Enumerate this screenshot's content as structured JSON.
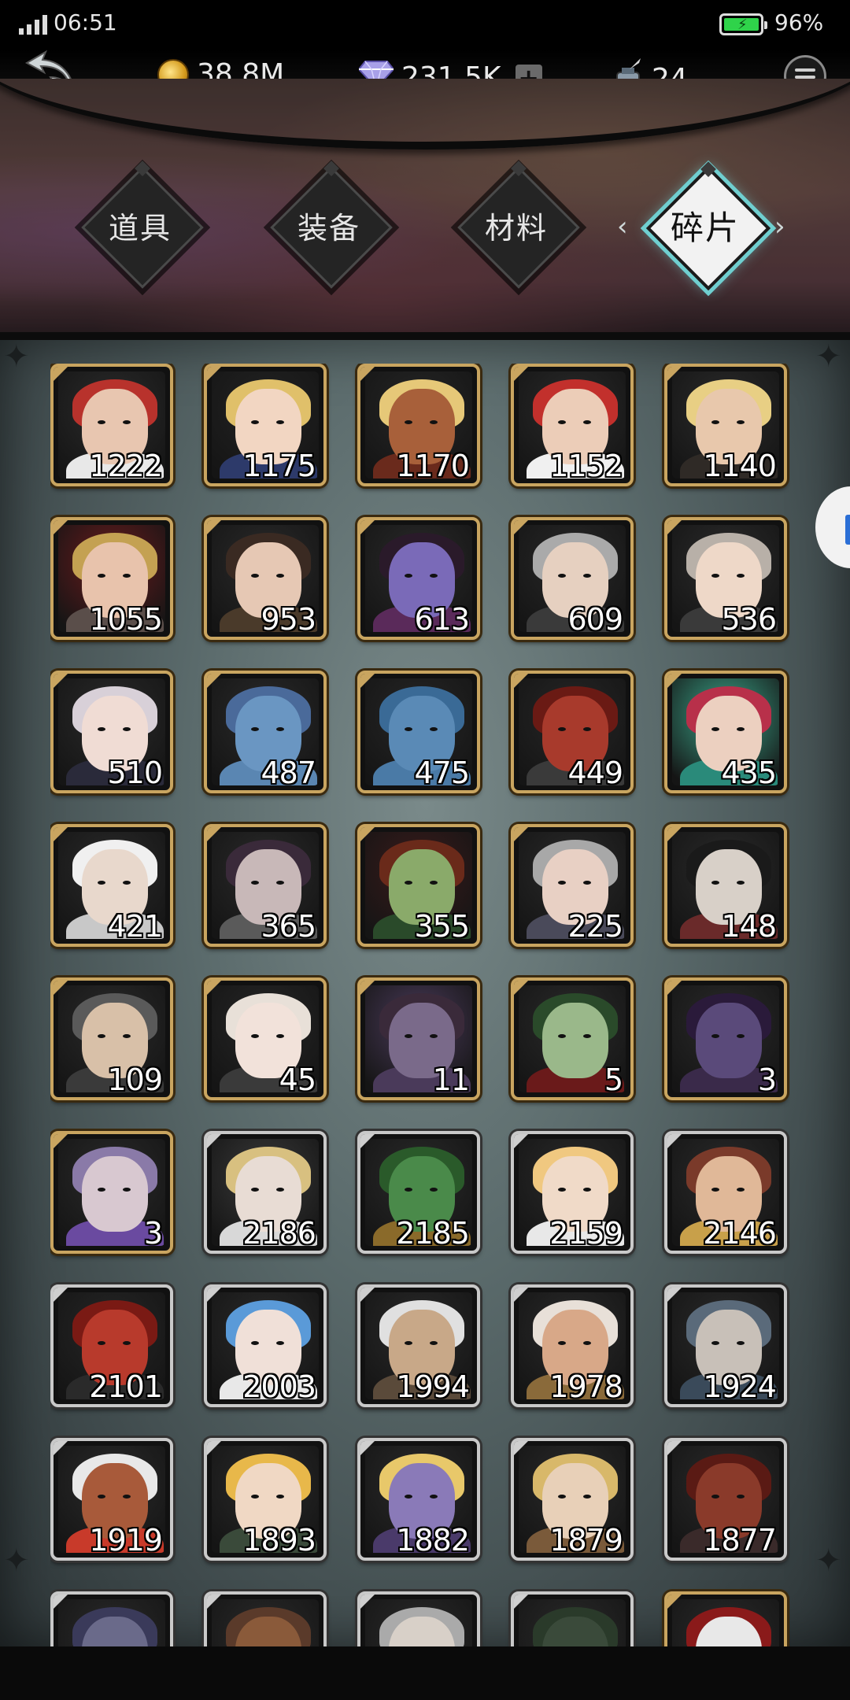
{
  "status": {
    "time": "06:51",
    "battery": "96%"
  },
  "resources": {
    "gold": "38.8M",
    "gems": "231.5K",
    "ink": "24"
  },
  "tabs": [
    {
      "label": "道具",
      "active": false
    },
    {
      "label": "装备",
      "active": false
    },
    {
      "label": "材料",
      "active": false
    },
    {
      "label": "碎片",
      "active": true
    }
  ],
  "shards": [
    {
      "count": "1222",
      "frame": "gold",
      "skin": "#e8c6b0",
      "hair": "#b8322c",
      "outfit": "#e8e8e8",
      "bg": "#2b2b2b"
    },
    {
      "count": "1175",
      "frame": "gold",
      "skin": "#f2d6c2",
      "hair": "#e0c06a",
      "outfit": "#2d3a6a",
      "bg": "#232323"
    },
    {
      "count": "1170",
      "frame": "gold",
      "skin": "#a8603a",
      "hair": "#e6c878",
      "outfit": "#6a2a1c",
      "bg": "#262626"
    },
    {
      "count": "1152",
      "frame": "gold",
      "skin": "#eccdb8",
      "hair": "#c2302c",
      "outfit": "#f0f0f0",
      "bg": "#2a2a2a"
    },
    {
      "count": "1140",
      "frame": "gold",
      "skin": "#e8c8ac",
      "hair": "#e8cf84",
      "outfit": "#2f2a26",
      "bg": "#2b2b2b"
    },
    {
      "count": "1055",
      "frame": "gold",
      "skin": "#e8c3ac",
      "hair": "#c4a152",
      "outfit": "#5a4e4a",
      "bg": "#6a1a1c"
    },
    {
      "count": "953",
      "frame": "gold",
      "skin": "#e6c8b4",
      "hair": "#3a2a22",
      "outfit": "#4a3a2a",
      "bg": "#2a2a2a"
    },
    {
      "count": "613",
      "frame": "gold",
      "skin": "#7a6ab8",
      "hair": "#2a1a2a",
      "outfit": "#5a2a5a",
      "bg": "#2a2a2a"
    },
    {
      "count": "609",
      "frame": "gold",
      "skin": "#e6d0c0",
      "hair": "#aaaaaa",
      "outfit": "#3a3a3a",
      "bg": "#282828"
    },
    {
      "count": "536",
      "frame": "gold",
      "skin": "#eed8c8",
      "hair": "#b8b0a8",
      "outfit": "#3a3a3a",
      "bg": "#2b2b2b"
    },
    {
      "count": "510",
      "frame": "gold",
      "skin": "#f0dcd4",
      "hair": "#d8d0d8",
      "outfit": "#2a2a3a",
      "bg": "#2a2a2a"
    },
    {
      "count": "487",
      "frame": "gold",
      "skin": "#6a96c2",
      "hair": "#4a6a9a",
      "outfit": "#5a86b2",
      "bg": "#2a2a2a"
    },
    {
      "count": "475",
      "frame": "gold",
      "skin": "#5a8ab6",
      "hair": "#3a6a96",
      "outfit": "#4a7aa6",
      "bg": "#262626"
    },
    {
      "count": "449",
      "frame": "gold",
      "skin": "#a83a2c",
      "hair": "#6a1a14",
      "outfit": "#3a3a3a",
      "bg": "#262626"
    },
    {
      "count": "435",
      "frame": "gold",
      "skin": "#ecd0c0",
      "hair": "#b8304a",
      "outfit": "#2a8a7a",
      "bg": "#3aa68a"
    },
    {
      "count": "421",
      "frame": "gold",
      "skin": "#e8d8cc",
      "hair": "#f0f0f0",
      "outfit": "#c8c8c8",
      "bg": "#2a2a2a"
    },
    {
      "count": "365",
      "frame": "gold",
      "skin": "#c8b8b8",
      "hair": "#3a2a3a",
      "outfit": "#5a5a5a",
      "bg": "#2a2a2a"
    },
    {
      "count": "355",
      "frame": "gold",
      "skin": "#8aaa6a",
      "hair": "#6a2a1a",
      "outfit": "#2a4a2a",
      "bg": "#3a1a1a"
    },
    {
      "count": "225",
      "frame": "gold",
      "skin": "#e8d0c4",
      "hair": "#a8a8a8",
      "outfit": "#4a4a5a",
      "bg": "#2a2a2a"
    },
    {
      "count": "148",
      "frame": "gold",
      "skin": "#d8d0c8",
      "hair": "#1a1a1a",
      "outfit": "#6a2a2a",
      "bg": "#2a2a2a"
    },
    {
      "count": "109",
      "frame": "gold",
      "skin": "#d8c0a8",
      "hair": "#5a5a5a",
      "outfit": "#3a3a3a",
      "bg": "#2a2a2a"
    },
    {
      "count": "45",
      "frame": "gold",
      "skin": "#f2e2da",
      "hair": "#e8e0d8",
      "outfit": "#3a3a3a",
      "bg": "#262626"
    },
    {
      "count": "11",
      "frame": "gold",
      "skin": "#7a6a8a",
      "hair": "#3a2a3a",
      "outfit": "#4a3a5a",
      "bg": "#4a3a5a"
    },
    {
      "count": "5",
      "frame": "gold",
      "skin": "#9ab88a",
      "hair": "#2a4a2a",
      "outfit": "#6a1a1a",
      "bg": "#2a2a2a"
    },
    {
      "count": "3",
      "frame": "gold",
      "skin": "#5a4a7a",
      "hair": "#2a1a3a",
      "outfit": "#3a2a4a",
      "bg": "#2a2a2a"
    },
    {
      "count": "3",
      "frame": "gold",
      "skin": "#d8c8d0",
      "hair": "#8a7aa8",
      "outfit": "#6a4aa0",
      "bg": "#2a2a2a"
    },
    {
      "count": "2186",
      "frame": "silver",
      "skin": "#e8dcd4",
      "hair": "#d8c080",
      "outfit": "#d8d8d8",
      "bg": "#3a3a3a"
    },
    {
      "count": "2185",
      "frame": "silver",
      "skin": "#4a8a4a",
      "hair": "#2a5a2a",
      "outfit": "#8a6a2a",
      "bg": "#2a2a2a"
    },
    {
      "count": "2159",
      "frame": "silver",
      "skin": "#f0dac8",
      "hair": "#f0c880",
      "outfit": "#e8e8e8",
      "bg": "#2a2a2a"
    },
    {
      "count": "2146",
      "frame": "silver",
      "skin": "#e0b898",
      "hair": "#7a3a2a",
      "outfit": "#c8a04a",
      "bg": "#2a2a2a"
    },
    {
      "count": "2101",
      "frame": "silver",
      "skin": "#b83a2c",
      "hair": "#7a1a14",
      "outfit": "#2a2a2a",
      "bg": "#262626"
    },
    {
      "count": "2003",
      "frame": "silver",
      "skin": "#f0e0d8",
      "hair": "#5a9ad8",
      "outfit": "#e8e8e8",
      "bg": "#2a2a2a"
    },
    {
      "count": "1994",
      "frame": "silver",
      "skin": "#c8a888",
      "hair": "#e0e0e0",
      "outfit": "#5a4a3a",
      "bg": "#2a2a2a"
    },
    {
      "count": "1978",
      "frame": "silver",
      "skin": "#d8a888",
      "hair": "#e8e0d8",
      "outfit": "#8a6a3a",
      "bg": "#2a2a2a"
    },
    {
      "count": "1924",
      "frame": "silver",
      "skin": "#c8c0b8",
      "hair": "#5a6a7a",
      "outfit": "#3a4a5a",
      "bg": "#2a2a2a"
    },
    {
      "count": "1919",
      "frame": "silver",
      "skin": "#a85a3a",
      "hair": "#e8e8e8",
      "outfit": "#c83a2a",
      "bg": "#2a2a2a"
    },
    {
      "count": "1893",
      "frame": "silver",
      "skin": "#f0d8c4",
      "hair": "#e8b84a",
      "outfit": "#3a4a3a",
      "bg": "#2a2a2a"
    },
    {
      "count": "1882",
      "frame": "silver",
      "skin": "#8a7ab8",
      "hair": "#e8c86a",
      "outfit": "#4a3a6a",
      "bg": "#2a2a2a"
    },
    {
      "count": "1879",
      "frame": "silver",
      "skin": "#e8d0b8",
      "hair": "#d8b86a",
      "outfit": "#7a5a3a",
      "bg": "#2a2a2a"
    },
    {
      "count": "1877",
      "frame": "silver",
      "skin": "#8a3a2a",
      "hair": "#5a1a14",
      "outfit": "#3a2a2a",
      "bg": "#2a2a2a"
    },
    {
      "count": "",
      "frame": "silver",
      "skin": "#6a6a8a",
      "hair": "#3a3a5a",
      "outfit": "#3a3a3a",
      "bg": "#2a2a2a"
    },
    {
      "count": "",
      "frame": "silver",
      "skin": "#8a5a3a",
      "hair": "#5a3a2a",
      "outfit": "#3a3a3a",
      "bg": "#2a2a2a"
    },
    {
      "count": "",
      "frame": "silver",
      "skin": "#d8d0c8",
      "hair": "#aaaaaa",
      "outfit": "#3a3a3a",
      "bg": "#2a2a2a"
    },
    {
      "count": "",
      "frame": "silver",
      "skin": "#3a4a3a",
      "hair": "#2a3a2a",
      "outfit": "#3a3a3a",
      "bg": "#2a2a2a"
    },
    {
      "count": "",
      "frame": "gold",
      "skin": "#e8e8e8",
      "hair": "#8a1a1a",
      "outfit": "#3a3a3a",
      "bg": "#2a2a2a"
    }
  ]
}
